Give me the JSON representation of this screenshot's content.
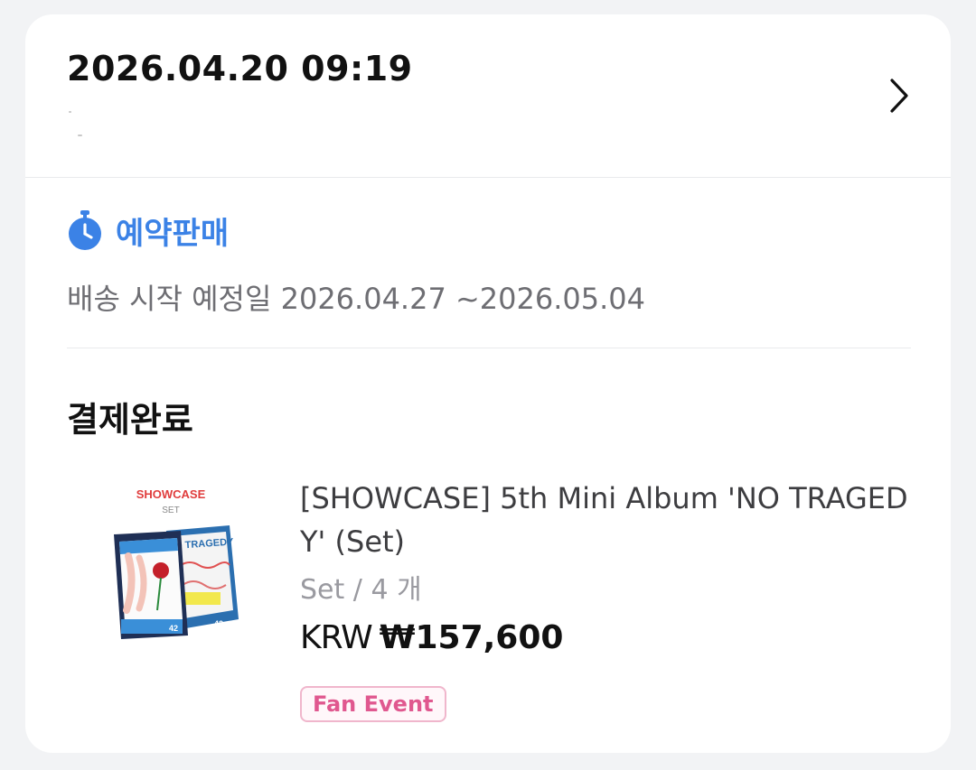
{
  "order": {
    "datetime": "2026.04.20 09:19"
  },
  "presale": {
    "label": "예약판매",
    "icon": "stopwatch-icon",
    "color": "#3b82e6",
    "shipping": "배송 시작 예정일 2026.04.27 ~2026.05.04"
  },
  "status": {
    "label": "결제완료"
  },
  "product": {
    "name": "[SHOWCASE] 5th Mini Album 'NO TRAGEDY' (Set)",
    "option": "Set / 4 개",
    "currency": "KRW",
    "price": "₩157,600",
    "tag": "Fan Event",
    "image": {
      "title": "SHOWCASE",
      "subtitle": "SET",
      "box_text": "NO TRAGEDY",
      "badge": "42"
    }
  },
  "colors": {
    "accent": "#3b82e6",
    "tag": "#e0588f"
  }
}
